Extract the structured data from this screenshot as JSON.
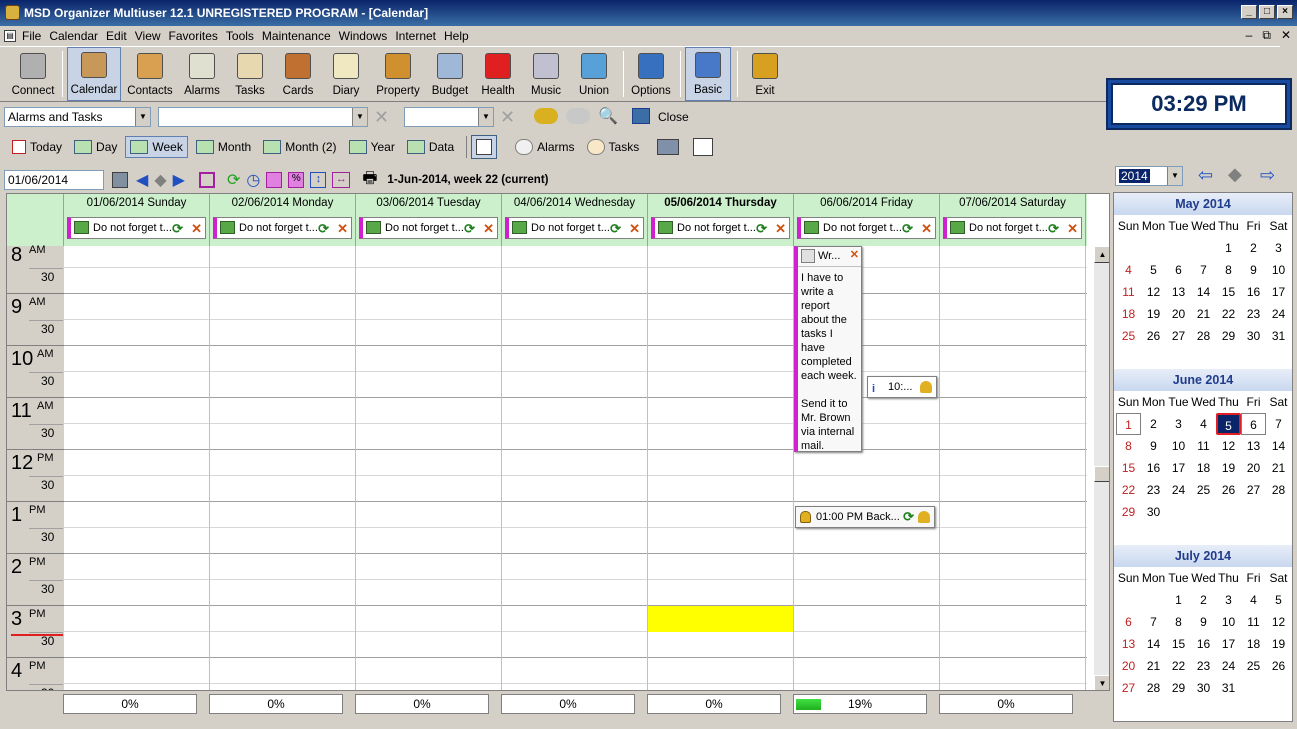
{
  "window": {
    "title": "MSD Organizer Multiuser 12.1 UNREGISTERED PROGRAM - [Calendar]"
  },
  "menu": [
    "File",
    "Calendar",
    "Edit",
    "View",
    "Favorites",
    "Tools",
    "Maintenance",
    "Windows",
    "Internet",
    "Help"
  ],
  "toolbar": [
    {
      "label": "Connect",
      "icon": "server-icon",
      "color": "#b0b0b0"
    },
    {
      "label": "Calendar",
      "icon": "calendar-icon",
      "color": "#c89858",
      "selected": true
    },
    {
      "label": "Contacts",
      "icon": "address-book-icon",
      "color": "#d8a050"
    },
    {
      "label": "Alarms",
      "icon": "alarm-clock-icon",
      "color": "#e0e0d0"
    },
    {
      "label": "Tasks",
      "icon": "checklist-icon",
      "color": "#e8d8b0"
    },
    {
      "label": "Cards",
      "icon": "card-file-icon",
      "color": "#c07030"
    },
    {
      "label": "Diary",
      "icon": "notepad-icon",
      "color": "#f0e8c0"
    },
    {
      "label": "Property",
      "icon": "house-icon",
      "color": "#d09030"
    },
    {
      "label": "Budget",
      "icon": "calculator-icon",
      "color": "#a0b8d8"
    },
    {
      "label": "Health",
      "icon": "red-cross-icon",
      "color": "#e02020"
    },
    {
      "label": "Music",
      "icon": "music-cd-icon",
      "color": "#c0c0d0"
    },
    {
      "label": "Union",
      "icon": "gears-icon",
      "color": "#58a0d8"
    },
    {
      "label": "Options",
      "icon": "options-gears-icon",
      "color": "#3870c0"
    },
    {
      "label": "Basic",
      "icon": "window-layout-icon",
      "color": "#4878c8",
      "selected": true
    },
    {
      "label": "Exit",
      "icon": "exit-door-icon",
      "color": "#d8a020"
    }
  ],
  "clock": "03:29 PM",
  "filter": {
    "category": "Alarms and Tasks",
    "close_label": "Close"
  },
  "views": [
    "Today",
    "Day",
    "Week",
    "Month",
    "Month (2)",
    "Year",
    "Data"
  ],
  "view_selected": "Week",
  "dropdown_buttons": [
    "Alarms",
    "Tasks"
  ],
  "nav": {
    "date": "01/06/2014",
    "label": "1-Jun-2014, week 22 (current)"
  },
  "days": [
    {
      "header": "01/06/2014 Sunday",
      "task": "Do not forget t...",
      "progress": "0%",
      "pct": 0
    },
    {
      "header": "02/06/2014 Monday",
      "task": "Do not forget t...",
      "progress": "0%",
      "pct": 0
    },
    {
      "header": "03/06/2014 Tuesday",
      "task": "Do not forget t...",
      "progress": "0%",
      "pct": 0
    },
    {
      "header": "04/06/2014 Wednesday",
      "task": "Do not forget t...",
      "progress": "0%",
      "pct": 0
    },
    {
      "header": "05/06/2014 Thursday",
      "task": "Do not forget t...",
      "progress": "0%",
      "pct": 0,
      "today": true
    },
    {
      "header": "06/06/2014 Friday",
      "task": "Do not forget t...",
      "progress": "19%",
      "pct": 19
    },
    {
      "header": "07/06/2014 Saturday",
      "task": "Do not forget t...",
      "progress": "0%",
      "pct": 0
    }
  ],
  "hours": [
    {
      "h": "8",
      "ap": "AM"
    },
    {
      "h": "9",
      "ap": "AM"
    },
    {
      "h": "10",
      "ap": "AM"
    },
    {
      "h": "11",
      "ap": "AM"
    },
    {
      "h": "12",
      "ap": "PM"
    },
    {
      "h": "1",
      "ap": "PM"
    },
    {
      "h": "2",
      "ap": "PM"
    },
    {
      "h": "3",
      "ap": "PM"
    },
    {
      "h": "4",
      "ap": "PM"
    }
  ],
  "half_label": "30",
  "events": {
    "report": {
      "title": "Wr...",
      "body": "I have to write a report about the tasks I have completed each week.\n\nSend it to Mr. Brown via internal mail."
    },
    "alarm": "10:...",
    "backup": "01:00 PM Back..."
  },
  "year_select": "2014",
  "mini_calendars": [
    {
      "title": "May 2014",
      "start": 4,
      "days": 31
    },
    {
      "title": "June 2014",
      "start": 0,
      "days": 30,
      "today": 5,
      "boxed": [
        1,
        6
      ]
    },
    {
      "title": "July 2014",
      "start": 2,
      "days": 31
    }
  ],
  "weekdays": [
    "Sun",
    "Mon",
    "Tue",
    "Wed",
    "Thu",
    "Fri",
    "Sat"
  ]
}
